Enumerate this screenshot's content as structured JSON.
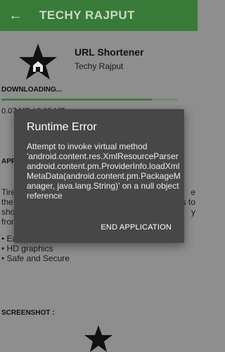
{
  "appbar": {
    "title": "TECHY RAJPUT",
    "back_icon": "arrow-left-icon"
  },
  "app": {
    "name": "URL Shortener",
    "developer": "Techy Rajput",
    "logo_icon": "star-home-logo"
  },
  "download": {
    "label": "DOWNLOADING...",
    "size_text": "0.07 MB / 0.00 MB",
    "progress": 0.85
  },
  "about": {
    "heading": "APP",
    "description_visible": "Tire\nthe\nsho\nfron",
    "desc_right": "e\nis to\ny"
  },
  "features": [
    "Ea",
    "HD graphics",
    "Safe and Secure"
  ],
  "screenshots": {
    "heading": "SCREENSHOT :"
  },
  "dialog": {
    "title": "Runtime Error",
    "message": "Attempt to invoke virtual method 'android.content.res.XmlResourceParser android.content.pm.ProviderInfo.loadXmlMetaData(android.content.pm.PackageManager, java.lang.String)' on a null object reference",
    "button_label": "END APPLICATION"
  }
}
